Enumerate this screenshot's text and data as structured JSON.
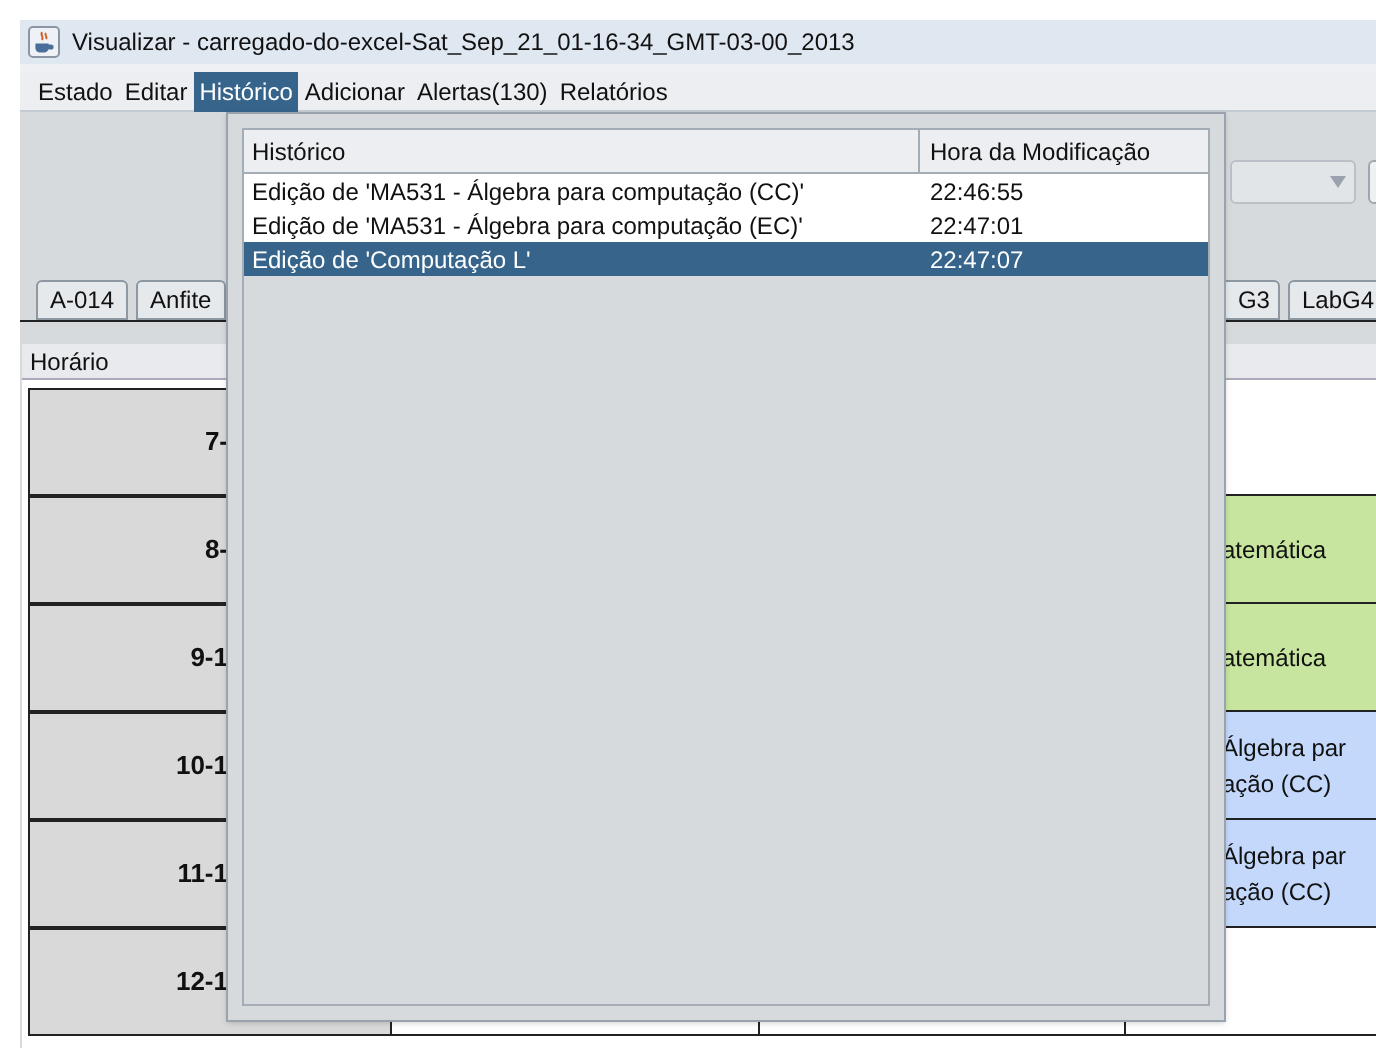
{
  "window": {
    "title": "Visualizar - carregado-do-excel-Sat_Sep_21_01-16-34_GMT-03-00_2013"
  },
  "menu_bar": [
    {
      "label": "Estado",
      "selected": false
    },
    {
      "label": "Editar",
      "selected": false
    },
    {
      "label": "Histórico",
      "selected": true
    },
    {
      "label": "Adicionar",
      "selected": false
    },
    {
      "label": "Alertas(130)",
      "selected": false
    },
    {
      "label": "Relatórios",
      "selected": false
    }
  ],
  "history_menu": {
    "columns": [
      "Histórico",
      "Hora da Modificação"
    ],
    "rows": [
      {
        "change": "Edição de 'MA531 - Álgebra para computação (CC)'",
        "time": "22:46:55",
        "selected": false
      },
      {
        "change": "Edição de 'MA531 - Álgebra para computação (EC)'",
        "time": "22:47:01",
        "selected": false
      },
      {
        "change": "Edição de 'Computação L'",
        "time": "22:47:07",
        "selected": true
      }
    ]
  },
  "room_tabs": [
    {
      "label": "A-014",
      "selected": false
    },
    {
      "label": "Anfite",
      "selected": false
    },
    {
      "label": "G3",
      "selected": false
    },
    {
      "label": "LabG4",
      "selected": false
    }
  ],
  "schedule": {
    "header": "Horário",
    "rows": [
      {
        "time": "7-",
        "color": "#ffffff"
      },
      {
        "time": "8-",
        "color": "#c7e59e",
        "slot_text": [
          "atemática"
        ]
      },
      {
        "time": "9-1",
        "color": "#c7e59e",
        "slot_text": [
          "atemática"
        ]
      },
      {
        "time": "10-1",
        "color": "#c3d8fb",
        "slot_text": [
          "Álgebra par",
          "ação (CC)"
        ]
      },
      {
        "time": "11-1",
        "color": "#c3d8fb",
        "slot_text": [
          "Álgebra par",
          "ação (CC)"
        ]
      },
      {
        "time": "12-1",
        "color": "#ffffff"
      }
    ]
  }
}
